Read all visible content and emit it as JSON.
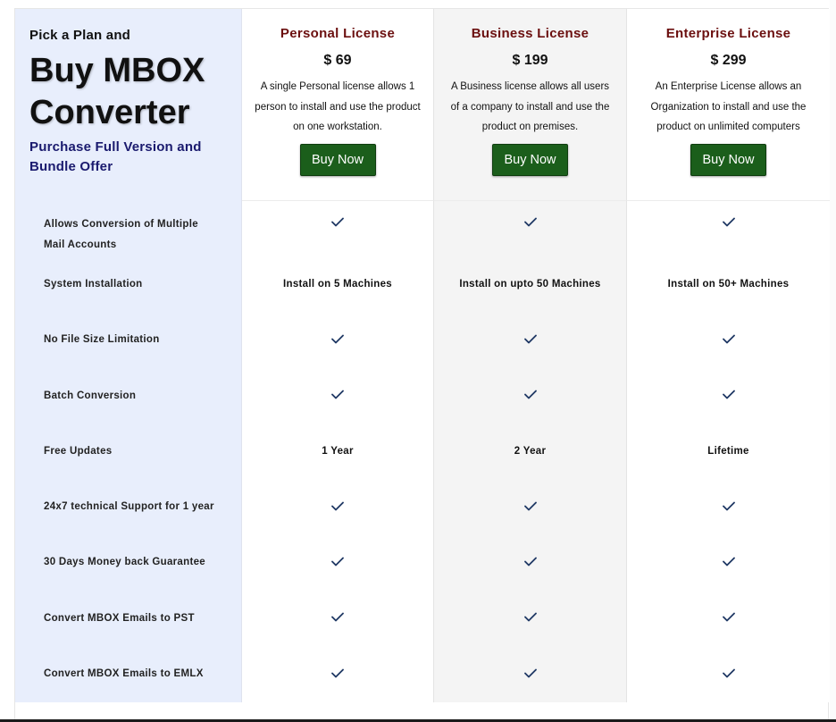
{
  "hero": {
    "pick": "Pick a Plan and",
    "title_line1": "Buy MBOX",
    "title_line2": "Converter",
    "sub_line1": "Purchase Full Version and",
    "sub_line2": "Bundle Offer"
  },
  "plans": [
    {
      "name": "Personal License",
      "price": "$ 69",
      "desc_lines": [
        "A single Personal license allows 1",
        "person to install and use the product",
        "on one workstation."
      ],
      "button": "Buy Now"
    },
    {
      "name": "Business License",
      "price": "$ 199",
      "desc_lines": [
        "A Business license allows all users",
        "of a company to install and use the",
        "product on premises."
      ],
      "button": "Buy Now"
    },
    {
      "name": "Enterprise License",
      "price": "$ 299",
      "desc_lines": [
        "An Enterprise License allows an",
        "Organization to install and use the",
        "product on unlimited computers"
      ],
      "button": "Buy Now"
    }
  ],
  "features": [
    {
      "label_lines": [
        "Allows Conversion of Multiple",
        "Mail Accounts"
      ],
      "values": [
        "check",
        "check",
        "check"
      ]
    },
    {
      "label_lines": [
        "System Installation"
      ],
      "values": [
        "Install on 5 Machines",
        "Install on upto 50 Machines",
        "Install on 50+ Machines"
      ]
    },
    {
      "label_lines": [
        "No File Size Limitation"
      ],
      "values": [
        "check",
        "check",
        "check"
      ]
    },
    {
      "label_lines": [
        "Batch Conversion"
      ],
      "values": [
        "check",
        "check",
        "check"
      ]
    },
    {
      "label_lines": [
        "Free Updates"
      ],
      "values": [
        "1 Year",
        "2 Year",
        "Lifetime"
      ]
    },
    {
      "label_lines": [
        "24x7 technical Support for 1 year"
      ],
      "values": [
        "check",
        "check",
        "check"
      ]
    },
    {
      "label_lines": [
        "30 Days Money back Guarantee"
      ],
      "values": [
        "check",
        "check",
        "check"
      ]
    },
    {
      "label_lines": [
        "Convert MBOX Emails to PST"
      ],
      "values": [
        "check",
        "check",
        "check"
      ]
    },
    {
      "label_lines": [
        "Convert MBOX Emails to EMLX"
      ],
      "values": [
        "check",
        "check",
        "check"
      ]
    }
  ],
  "colors": {
    "plan_name": "#6b0f0f",
    "subtitle": "#1a1a6e",
    "button_bg": "#1b5e1b",
    "checkmark": "#1f3864",
    "label_column_bg": "#e8eefc",
    "business_column_bg": "#f4f4f4"
  },
  "icons": {
    "check": "checkmark-icon"
  }
}
